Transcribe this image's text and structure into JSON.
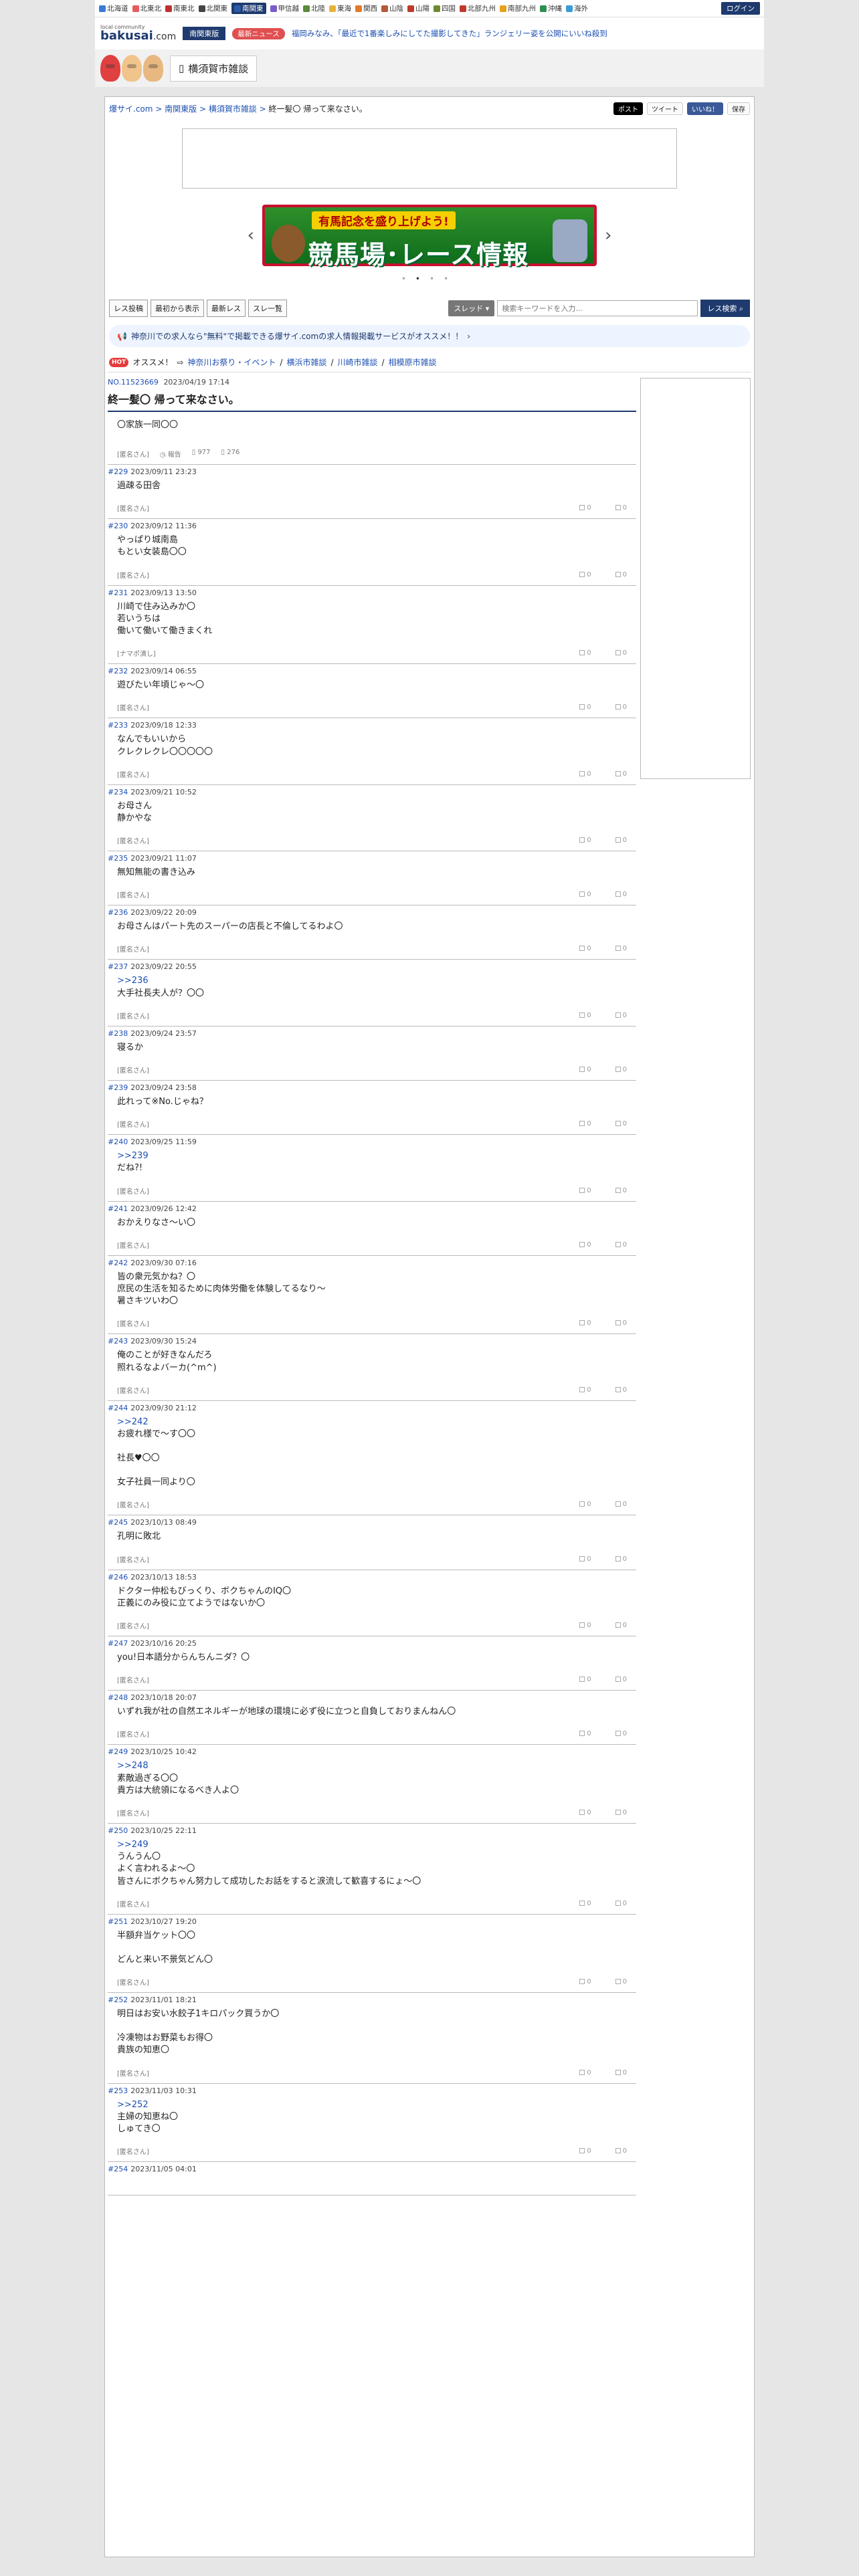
{
  "regions": [
    {
      "label": "北海道",
      "color": "#3a7bd5"
    },
    {
      "label": "北東北",
      "color": "#e65c5c"
    },
    {
      "label": "南東北",
      "color": "#c03030"
    },
    {
      "label": "北関東",
      "color": "#444"
    },
    {
      "label": "南関東",
      "color": "#2b5aa8",
      "active": true
    },
    {
      "label": "甲信越",
      "color": "#7a5cc9"
    },
    {
      "label": "北陸",
      "color": "#5a8a3a"
    },
    {
      "label": "東海",
      "color": "#e8b23a"
    },
    {
      "label": "関西",
      "color": "#e07a2a"
    },
    {
      "label": "山陰",
      "color": "#b35a3a"
    },
    {
      "label": "山陽",
      "color": "#c0392b"
    },
    {
      "label": "四国",
      "color": "#6c8a2f"
    },
    {
      "label": "北部九州",
      "color": "#c0392b"
    },
    {
      "label": "南部九州",
      "color": "#e6a21a"
    },
    {
      "label": "沖縄",
      "color": "#2f8f4e"
    },
    {
      "label": "海外",
      "color": "#3a9bd5"
    }
  ],
  "login_label": "ログイン",
  "logo": {
    "small": "local community",
    "name": "bakusai",
    "suffix": ".com"
  },
  "area_label": "南関東版",
  "news": {
    "tag": "最新ニュース",
    "text": "福岡みなみ、「最近で1番楽しみにしてた撮影してきた」ランジェリー姿を公開にいいね殺到"
  },
  "category_label": "横須賀市雑談",
  "breadcrumb": {
    "site": "爆サイ.com",
    "area": "南関東版",
    "board": "横須賀市雑談",
    "current": "終一髪〇 帰って来なさい。"
  },
  "share": {
    "x": "ポスト",
    "tweet": "ツイート",
    "fb": "いいね！",
    "save": "保存"
  },
  "banner": {
    "top": "有馬記念を盛り上げよう!",
    "main": "競馬場･レース情報"
  },
  "toolbar": {
    "post": "レス投稿",
    "from_first": "最初から表示",
    "latest": "最新レス",
    "list": "スレ一覧"
  },
  "search": {
    "select": "スレッド",
    "placeholder": "検索キーワードを入力...",
    "button": "レス検索"
  },
  "promo": "神奈川での求人なら\"無料\"で掲載できる爆サイ.comの求人情報掲載サービスがオススメ！！",
  "reco": {
    "hot": "HOT",
    "label": "オススメ！",
    "links": [
      "神奈川お祭り・イベント",
      "横浜市雑談",
      "川崎市雑談",
      "相模原市雑談"
    ]
  },
  "thread": {
    "no": "NO.11523669",
    "date": "2023/04/19 17:14",
    "title": "終一髪〇 帰って来なさい。",
    "body": "〇家族一同〇〇",
    "author": "[匿名さん]",
    "report": "報告",
    "views": "977",
    "count": "276"
  },
  "posts": [
    {
      "no": "#229",
      "date": "2023/09/11 23:23",
      "lines": [
        "過疎る田舎"
      ],
      "author": "[匿名さん]"
    },
    {
      "no": "#230",
      "date": "2023/09/12 11:36",
      "lines": [
        "やっぱり城南島",
        "もとい女装島〇〇"
      ],
      "author": "[匿名さん]"
    },
    {
      "no": "#231",
      "date": "2023/09/13 13:50",
      "lines": [
        "川崎で住み込みか〇",
        "若いうちは",
        "働いて働いて働きまくれ"
      ],
      "author": "[ナマポ潰し]"
    },
    {
      "no": "#232",
      "date": "2023/09/14 06:55",
      "lines": [
        "遊びたい年頃じゃ〜〇"
      ],
      "author": "[匿名さん]"
    },
    {
      "no": "#233",
      "date": "2023/09/18 12:33",
      "lines": [
        "なんでもいいから",
        "クレクレクレ〇〇〇〇〇"
      ],
      "author": "[匿名さん]"
    },
    {
      "no": "#234",
      "date": "2023/09/21 10:52",
      "lines": [
        "お母さん",
        "静かやな"
      ],
      "author": "[匿名さん]"
    },
    {
      "no": "#235",
      "date": "2023/09/21 11:07",
      "lines": [
        "無知無能の書き込み"
      ],
      "author": "[匿名さん]"
    },
    {
      "no": "#236",
      "date": "2023/09/22 20:09",
      "lines": [
        "お母さんはパート先のスーパーの店長と不倫してるわよ〇"
      ],
      "author": "[匿名さん]"
    },
    {
      "no": "#237",
      "date": "2023/09/22 20:55",
      "anchor": ">>236",
      "lines": [
        "大手社長夫人が？〇〇"
      ],
      "author": "[匿名さん]"
    },
    {
      "no": "#238",
      "date": "2023/09/24 23:57",
      "lines": [
        "寝るか"
      ],
      "author": "[匿名さん]"
    },
    {
      "no": "#239",
      "date": "2023/09/24 23:58",
      "lines": [
        "此れって※No.じゃね？"
      ],
      "author": "[匿名さん]"
    },
    {
      "no": "#240",
      "date": "2023/09/25 11:59",
      "anchor": ">>239",
      "lines": [
        "だね?!"
      ],
      "author": "[匿名さん]"
    },
    {
      "no": "#241",
      "date": "2023/09/26 12:42",
      "lines": [
        "おかえりなさ〜い〇"
      ],
      "author": "[匿名さん]"
    },
    {
      "no": "#242",
      "date": "2023/09/30 07:16",
      "lines": [
        "皆の衆元気かね？〇",
        "庶民の生活を知るために肉体労働を体験してるなり〜",
        "暑さキツいわ〇"
      ],
      "author": "[匿名さん]"
    },
    {
      "no": "#243",
      "date": "2023/09/30 15:24",
      "lines": [
        "俺のことが好きなんだろ",
        "照れるなよバーカ(^m^)"
      ],
      "author": "[匿名さん]"
    },
    {
      "no": "#244",
      "date": "2023/09/30 21:12",
      "anchor": ">>242",
      "lines": [
        "お疲れ様で〜す〇〇",
        "",
        "社長♥〇〇",
        "",
        "女子社員一同より〇"
      ],
      "author": "[匿名さん]"
    },
    {
      "no": "#245",
      "date": "2023/10/13 08:49",
      "lines": [
        "孔明に敗北"
      ],
      "author": "[匿名さん]"
    },
    {
      "no": "#246",
      "date": "2023/10/13 18:53",
      "lines": [
        "ドクター仲松もびっくり、ボクちゃんのIQ〇",
        "正義にのみ役に立てようではないか〇"
      ],
      "author": "[匿名さん]"
    },
    {
      "no": "#247",
      "date": "2023/10/16 20:25",
      "lines": [
        "you!日本語分からんちんニダ？〇"
      ],
      "author": "[匿名さん]"
    },
    {
      "no": "#248",
      "date": "2023/10/18 20:07",
      "lines": [
        "いずれ我が社の自然エネルギーが地球の環境に必ず役に立つと自負しておりまんねん〇"
      ],
      "author": "[匿名さん]"
    },
    {
      "no": "#249",
      "date": "2023/10/25 10:42",
      "anchor": ">>248",
      "lines": [
        "素敵過ぎる〇〇",
        "貴方は大統領になるべき人よ〇"
      ],
      "author": "[匿名さん]"
    },
    {
      "no": "#250",
      "date": "2023/10/25 22:11",
      "anchor": ">>249",
      "lines": [
        "うんうん〇",
        "よく言われるよ〜〇",
        "皆さんにボクちゃん努力して成功したお話をすると涙流して歓喜するにょ〜〇"
      ],
      "author": "[匿名さん]"
    },
    {
      "no": "#251",
      "date": "2023/10/27 19:20",
      "lines": [
        "半額弁当ケット〇〇",
        "",
        "どんと来い不景気どん〇"
      ],
      "author": "[匿名さん]"
    },
    {
      "no": "#252",
      "date": "2023/11/01 18:21",
      "lines": [
        "明日はお安い水餃子1キロパック買うか〇",
        "",
        "冷凍物はお野菜もお得〇",
        "貴族の知恵〇"
      ],
      "author": "[匿名さん]"
    },
    {
      "no": "#253",
      "date": "2023/11/03 10:31",
      "anchor": ">>252",
      "lines": [
        "主婦の知恵ね〇",
        "しゅてき〇"
      ],
      "author": "[匿名さん]"
    },
    {
      "no": "#254",
      "date": "2023/11/05 04:01",
      "lines": [
        ""
      ],
      "author": ""
    }
  ],
  "vote_up": "0",
  "vote_down": "0"
}
